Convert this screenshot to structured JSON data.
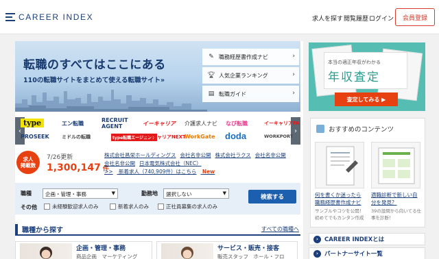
{
  "header": {
    "logo_text": "CAREER INDEX",
    "nav": [
      "求人を探す",
      "閲覧履歴",
      "ログイン"
    ],
    "register_label": "会員登録"
  },
  "hero": {
    "title": "転職のすべてはここにある",
    "subtitle": "110の転職サイトをまとめて使える転職サイト»",
    "menu": [
      {
        "icon": "pencil-icon",
        "label": "職務経歴書作成ナビ"
      },
      {
        "icon": "trophy-icon",
        "label": "人気企業ランキング"
      },
      {
        "icon": "book-icon",
        "label": "転職ガイド"
      }
    ]
  },
  "brands": {
    "row1": [
      "type",
      "エン転職",
      "RECRUIT AGENT",
      "イーキャリア",
      "介護求人ナビ",
      "なび転職",
      "イーキャリアFA"
    ],
    "row2": [
      "PROSEEK",
      "ミドルの転職",
      "type転職エージェント",
      "イーキャリアNEXT",
      "WorkGate",
      "doda",
      "WORKPORT"
    ]
  },
  "counter": {
    "badge_line1": "求人",
    "badge_line2": "掲載数",
    "updated": "7/26更新",
    "count": "1,300,147",
    "unit": "件",
    "companies": [
      "株式会社昌栄ホールディングス",
      "会社名非公開",
      "株式会社ラクス",
      "会社名非公開",
      "会社名非公開",
      "日本電気株式会社（NEC）"
    ],
    "new_prefix": ">>",
    "new_text": "新着求人（740,909件）はこちら",
    "new_badge": "New"
  },
  "search": {
    "job_label": "職種",
    "job_value": "企画・管理・事務",
    "location_label": "勤務地",
    "location_value": "選択しない",
    "other_label": "その他",
    "checks": [
      "未経験歓迎求人のみ",
      "新着求人のみ",
      "正社員募集の求人のみ"
    ],
    "button": "検索する"
  },
  "occupation": {
    "title": "職種から探す",
    "all_link": "すべての職種へ",
    "cards": [
      {
        "name": "企画・管理・事務",
        "sub": "商品企画　マーケティング"
      },
      {
        "name": "サービス・販売・接客",
        "sub": "販売スタッフ　ホール・フロ"
      }
    ]
  },
  "ad": {
    "small": "本当の適正年収がわかる",
    "big": "年収査定",
    "button": "査定してみる ▶"
  },
  "recommended": {
    "title": "おすすめのコンテンツ",
    "cards": [
      {
        "link": "何を書くか迷ったら職務経歴書作成ナビ",
        "desc": "サンプルやコツを公開！初めてでもカンタン作成"
      },
      {
        "link": "適職診断で新しい自分を発見？",
        "desc": "39の設問から向いてる仕事を診断！"
      }
    ]
  },
  "side_links": [
    "CAREER INDEXとは",
    "パートナーサイト一覧"
  ],
  "colors": {
    "brand": "#1b3f7a",
    "accent": "#e74011",
    "register": "#d83b2b",
    "ad_bg": "#56bdb3"
  }
}
